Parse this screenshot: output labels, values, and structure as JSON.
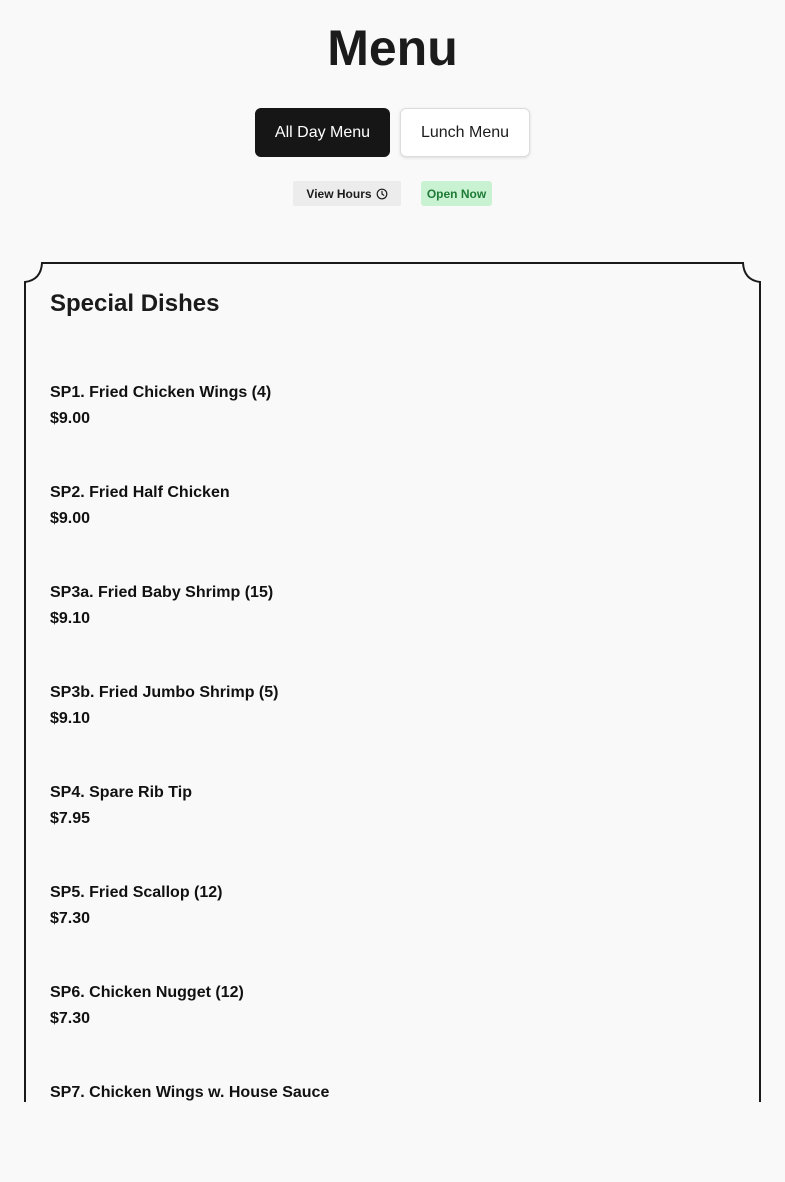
{
  "page": {
    "title": "Menu"
  },
  "tabs": [
    {
      "label": "All Day Menu",
      "active": true
    },
    {
      "label": "Lunch Menu",
      "active": false
    }
  ],
  "hours": {
    "view_label": "View Hours",
    "status": "Open Now",
    "icon": "clock-icon"
  },
  "section": {
    "title": "Special Dishes",
    "items": [
      {
        "name": "SP1. Fried Chicken Wings (4)",
        "price": "$9.00"
      },
      {
        "name": "SP2. Fried Half Chicken",
        "price": "$9.00"
      },
      {
        "name": "SP3a. Fried Baby Shrimp (15)",
        "price": "$9.10"
      },
      {
        "name": "SP3b. Fried Jumbo Shrimp (5)",
        "price": "$9.10"
      },
      {
        "name": "SP4. Spare Rib Tip",
        "price": "$7.95"
      },
      {
        "name": "SP5. Fried Scallop (12)",
        "price": "$7.30"
      },
      {
        "name": "SP6. Chicken Nugget (12)",
        "price": "$7.30"
      },
      {
        "name": "SP7. Chicken Wings w. House Sauce",
        "price": ""
      }
    ]
  },
  "colors": {
    "background": "#f9f9f9",
    "active_tab": "#161616",
    "open_badge_bg": "#c9f2d3",
    "open_badge_text": "#1e7a35"
  }
}
